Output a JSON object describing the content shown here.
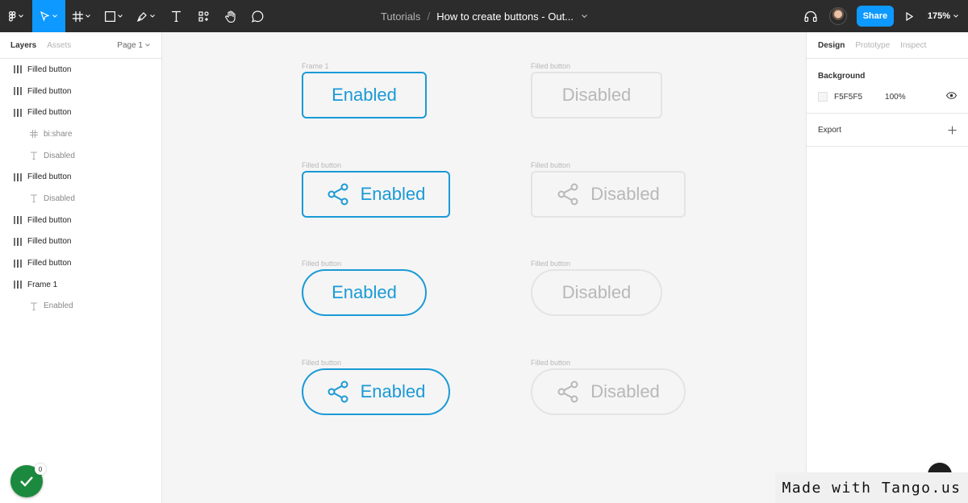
{
  "toolbar": {
    "breadcrumb_project": "Tutorials",
    "breadcrumb_separator": "/",
    "file_name": "How to create buttons - Out...",
    "share_label": "Share",
    "zoom_label": "175%"
  },
  "left_panel": {
    "tabs": [
      "Layers",
      "Assets"
    ],
    "page_selector": "Page 1",
    "layers": [
      {
        "name": "Filled button",
        "type": "frame",
        "level": 0
      },
      {
        "name": "Filled button",
        "type": "frame",
        "level": 0
      },
      {
        "name": "Filled button",
        "type": "frame",
        "level": 0
      },
      {
        "name": "bi:share",
        "type": "component",
        "level": 1
      },
      {
        "name": "Disabled",
        "type": "text",
        "level": 1
      },
      {
        "name": "Filled button",
        "type": "frame",
        "level": 0
      },
      {
        "name": "Disabled",
        "type": "text",
        "level": 1
      },
      {
        "name": "Filled button",
        "type": "frame",
        "level": 0
      },
      {
        "name": "Filled button",
        "type": "frame",
        "level": 0
      },
      {
        "name": "Filled button",
        "type": "frame",
        "level": 0
      },
      {
        "name": "Frame 1",
        "type": "frame",
        "level": 0
      },
      {
        "name": "Enabled",
        "type": "text",
        "level": 1
      }
    ],
    "notification_count": "0"
  },
  "canvas": {
    "rows": [
      {
        "left_label": "Frame 1",
        "left_text": "Enabled",
        "right_label": "Filled button",
        "right_text": "Disabled"
      },
      {
        "left_label": "Filled button",
        "left_text": "Enabled",
        "right_label": "Filled button",
        "right_text": "Disabled"
      },
      {
        "left_label": "Filled button",
        "left_text": "Enabled",
        "right_label": "Filled button",
        "right_text": "Disabled"
      },
      {
        "left_label": "Filled button",
        "left_text": "Enabled",
        "right_label": "Filled button",
        "right_text": "Disabled"
      }
    ],
    "enabled_color": "#1a9ad6",
    "disabled_color": "#b8b8b8"
  },
  "right_panel": {
    "tabs": [
      "Design",
      "Prototype",
      "Inspect"
    ],
    "background_title": "Background",
    "background_hex": "F5F5F5",
    "background_opacity": "100%",
    "export_label": "Export"
  },
  "watermark": "Made with Tango.us",
  "colors": {
    "toolbar_bg": "#2c2c2c",
    "accent": "#0d99ff",
    "canvas_bg": "#f5f5f5"
  }
}
